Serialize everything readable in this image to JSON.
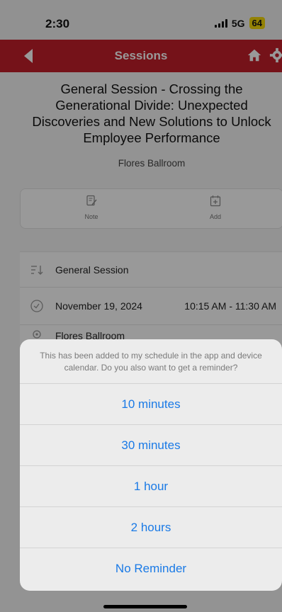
{
  "status_bar": {
    "time": "2:30",
    "network": "5G",
    "battery": "64"
  },
  "navbar": {
    "title": "Sessions",
    "back_icon": "back-arrow-icon",
    "home_icon": "home-icon",
    "settings_icon": "gear-icon"
  },
  "session": {
    "title": "General Session - Crossing the Generational Divide: Unexpected Discoveries and New Solutions to Unlock Employee Performance",
    "room": "Flores Ballroom"
  },
  "actions": [
    {
      "label": "Note",
      "icon": "note-icon"
    },
    {
      "label": "Add",
      "icon": "calendar-add-icon"
    }
  ],
  "details": {
    "type": "General Session",
    "date": "November 19, 2024",
    "time": "10:15 AM - 11:30 AM",
    "location_partial": "Flores Ballroom"
  },
  "reminder_sheet": {
    "message": "This has been added to my schedule in the app and device calendar.  Do you also want to get a reminder?",
    "options": [
      "10 minutes",
      "30 minutes",
      "1 hour",
      "2 hours",
      "No Reminder"
    ]
  },
  "colors": {
    "brand_red": "#c31f2a",
    "action_blue": "#1a7ae6"
  }
}
